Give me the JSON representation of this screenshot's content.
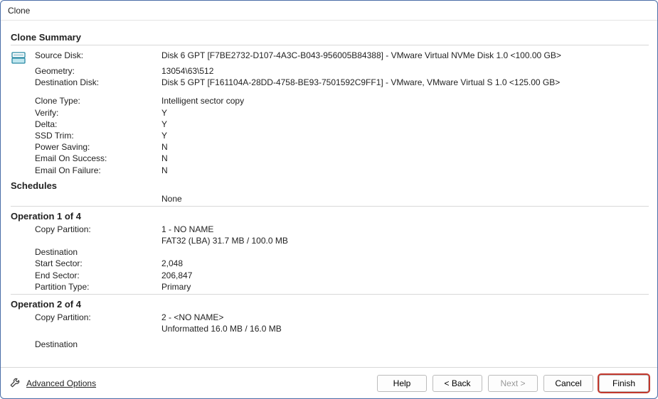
{
  "window_title": "Clone",
  "summary": {
    "title": "Clone Summary",
    "source_disk_label": "Source Disk:",
    "source_disk_value": "Disk 6 GPT [F7BE2732-D107-4A3C-B043-956005B84388] - VMware Virtual NVMe Disk 1.0  <100.00 GB>",
    "geometry_label": "Geometry:",
    "geometry_value": "13054\\63\\512",
    "dest_disk_label": "Destination Disk:",
    "dest_disk_value": "Disk 5 GPT [F161104A-28DD-4758-BE93-7501592C9FF1] - VMware,  VMware Virtual S 1.0  <125.00 GB>",
    "clone_type_label": "Clone Type:",
    "clone_type_value": "Intelligent sector copy",
    "verify_label": "Verify:",
    "verify_value": "Y",
    "delta_label": "Delta:",
    "delta_value": "Y",
    "ssd_trim_label": "SSD Trim:",
    "ssd_trim_value": "Y",
    "power_saving_label": "Power Saving:",
    "power_saving_value": "N",
    "email_success_label": "Email On Success:",
    "email_success_value": "N",
    "email_failure_label": "Email On Failure:",
    "email_failure_value": "N"
  },
  "schedules": {
    "title": "Schedules",
    "value": "None"
  },
  "operations": [
    {
      "title": "Operation 1 of 4",
      "copy_label": "Copy Partition:",
      "copy_value_line1": "1 - NO NAME",
      "copy_value_line2": "FAT32 (LBA) 31.7 MB / 100.0 MB",
      "dest_label": "Destination",
      "start_label": "Start Sector:",
      "start_value": "2,048",
      "end_label": "End Sector:",
      "end_value": "206,847",
      "ptype_label": "Partition Type:",
      "ptype_value": "Primary"
    },
    {
      "title": "Operation 2 of 4",
      "copy_label": "Copy Partition:",
      "copy_value_line1": "2 - <NO NAME>",
      "copy_value_line2": "Unformatted 16.0 MB / 16.0 MB",
      "dest_label": "Destination"
    }
  ],
  "footer": {
    "advanced": "Advanced Options",
    "help": "Help",
    "back": "< Back",
    "next": "Next >",
    "cancel": "Cancel",
    "finish": "Finish"
  }
}
